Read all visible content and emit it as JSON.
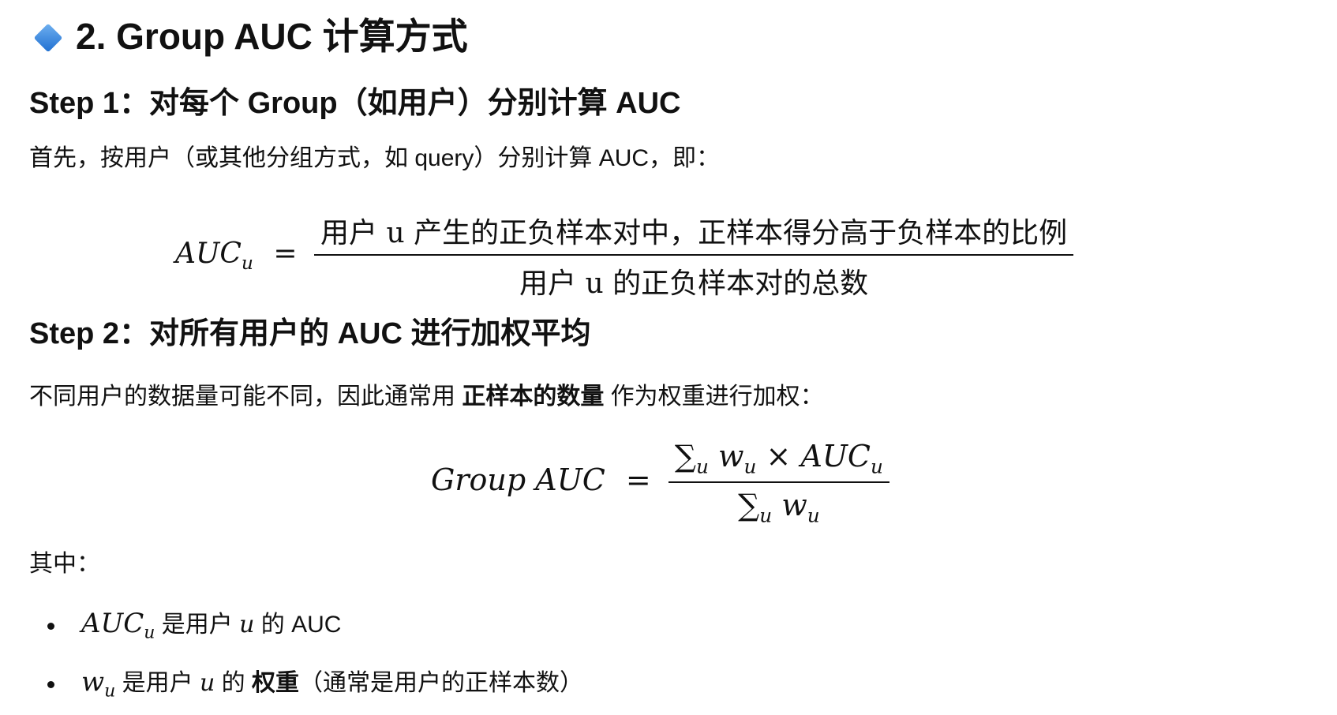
{
  "heading": {
    "icon": "blue-diamond-icon",
    "title": "2. Group AUC 计算方式"
  },
  "step1": {
    "title": "Step 1：对每个 Group（如用户）分别计算 AUC",
    "intro": "首先，按用户（或其他分组方式，如 query）分别计算 AUC，即：",
    "formula": {
      "lhs": "AUC",
      "lhs_sub": "u",
      "eq": "=",
      "numerator": "用户 u 产生的正负样本对中，正样本得分高于负样本的比例",
      "denominator": "用户 u 的正负样本对的总数"
    }
  },
  "step2": {
    "title": "Step 2：对所有用户的 AUC 进行加权平均",
    "intro_before": "不同用户的数据量可能不同，因此通常用 ",
    "intro_bold": "正样本的数量",
    "intro_after": " 作为权重进行加权：",
    "formula": {
      "lhs": "Group AUC",
      "eq": "=",
      "num_sum": "∑",
      "num_sum_sub": "u",
      "num_w": "w",
      "num_w_sub": "u",
      "times": "×",
      "num_auc": "AUC",
      "num_auc_sub": "u",
      "den_sum": "∑",
      "den_sum_sub": "u",
      "den_w": "w",
      "den_w_sub": "u"
    }
  },
  "where": {
    "label": "其中：",
    "items": [
      {
        "sym": "AUC",
        "sym_sub": "u",
        "text_before": " 是用户 ",
        "var": "u",
        "text_after": " 的 AUC",
        "bold": "",
        "tail": ""
      },
      {
        "sym": "w",
        "sym_sub": "u",
        "text_before": " 是用户 ",
        "var": "u",
        "text_after": " 的 ",
        "bold": "权重",
        "tail": "（通常是用户的正样本数）"
      }
    ]
  }
}
